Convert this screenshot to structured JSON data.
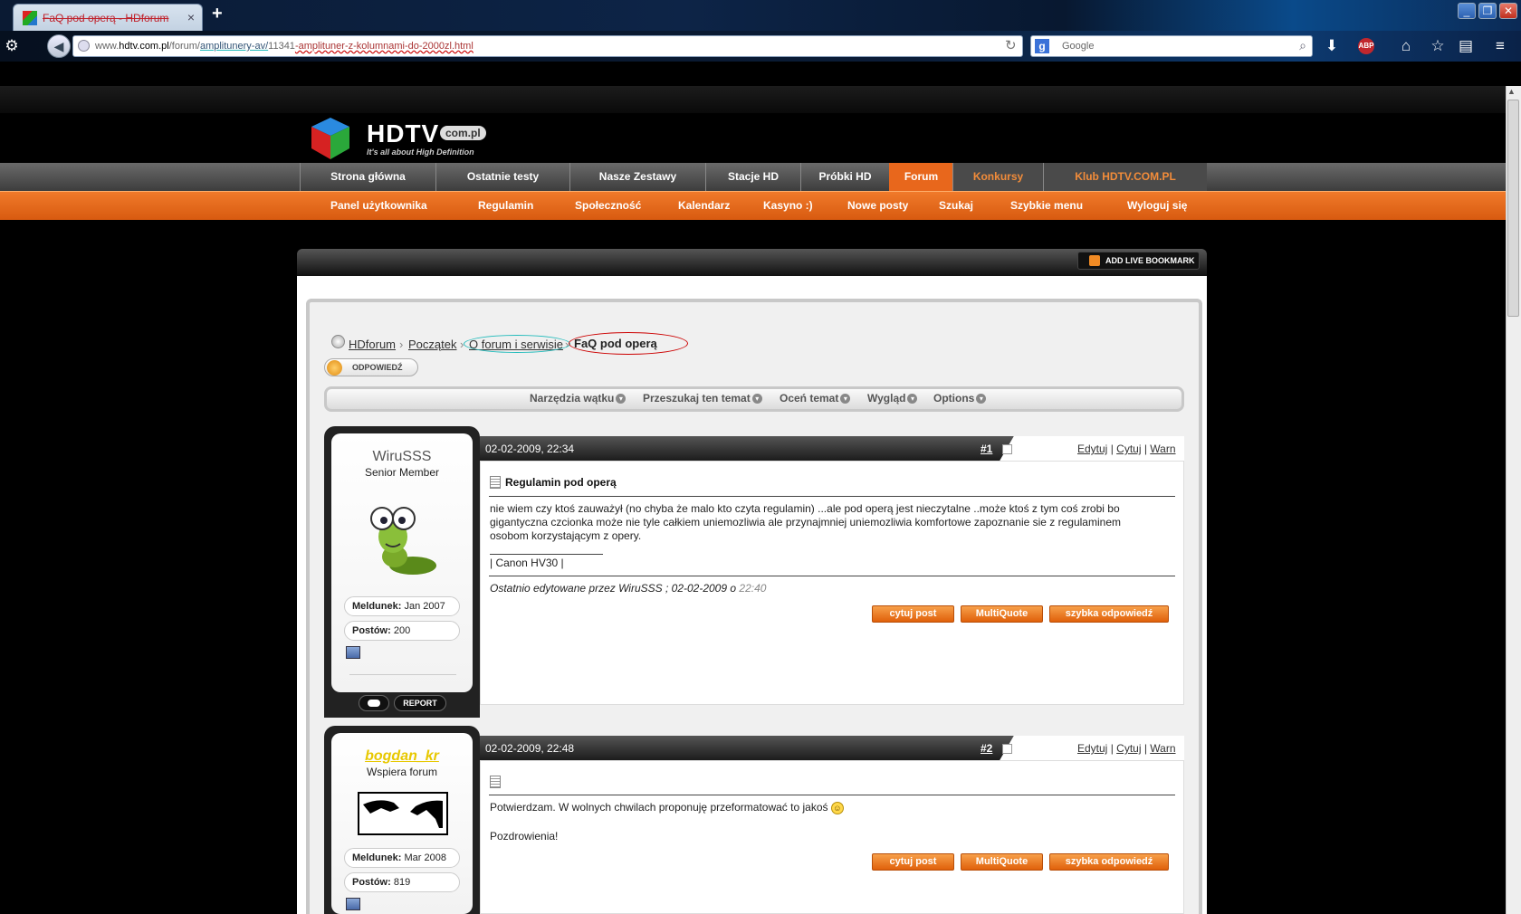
{
  "browser": {
    "tab_title": "FaQ pod operą - HDforum",
    "tab_close": "×",
    "new_tab": "+",
    "url_prefix": "www.",
    "url_domain": "hdtv.com.pl",
    "url_path_a": "/forum/",
    "url_path_b": "amplitunery-av/",
    "url_path_c": "11341",
    "url_path_d": "-amplituner-z-kolumnami-do-2000zl.html",
    "search_placeholder": "Google",
    "search_engine_letter": "g",
    "abp_label": "ABP"
  },
  "site": {
    "logo_text": "HDTV",
    "logo_badge": "com.pl",
    "logo_tagline": "It's all about High Definition",
    "main_nav": [
      "Strona główna",
      "Ostatnie testy",
      "Nasze Zestawy",
      "Stacje HD",
      "Próbki HD",
      "Forum",
      "Konkursy",
      "Klub HDTV.COM.PL"
    ],
    "sub_nav": [
      "Panel użytkownika",
      "Regulamin",
      "Społeczność",
      "Kalendarz",
      "Kasyno :)",
      "Nowe posty",
      "Szukaj",
      "Szybkie menu",
      "Wyloguj się"
    ],
    "rss_label": "ADD LIVE BOOKMARK"
  },
  "breadcrumb": {
    "items": [
      "HDforum",
      "Początek",
      "O forum i serwisie"
    ],
    "separator": "›",
    "current": "FaQ pod operą"
  },
  "reply_button": "ODPOWIEDŹ",
  "tools": [
    "Narzędzia wątku",
    "Przeszukaj ten temat",
    "Oceń temat",
    "Wygląd",
    "Options"
  ],
  "posts": [
    {
      "date": "02-02-2009, 22:34",
      "number": "#1",
      "links": [
        "Edytuj",
        "Cytuj",
        "Warn"
      ],
      "user": "WiruSSS",
      "rank": "Senior Member",
      "joined_label": "Meldunek:",
      "joined": "Jan 2007",
      "posts_label": "Postów:",
      "posts": "200",
      "title": "Regulamin pod operą",
      "text": "nie wiem czy ktoś zauważył (no chyba że malo kto czyta regulamin) ...ale pod operą jest nieczytalne ..może ktoś z tym coś zrobi bo gigantyczna czcionka może nie tyle całkiem uniemozliwia ale przynajmniej uniemozliwia komfortowe zapoznanie sie z regulaminem osobom korzystającym z opery.",
      "signature": "| Canon HV30 |",
      "edited_prefix": "Ostatnio edytowane przez WiruSSS ; 02-02-2009 o",
      "edited_time": "22:40",
      "report_label": "REPORT",
      "user_color": "#444444"
    },
    {
      "date": "02-02-2009, 22:48",
      "number": "#2",
      "links": [
        "Edytuj",
        "Cytuj",
        "Warn"
      ],
      "user": "bogdan_kr",
      "rank": "Wspiera forum",
      "joined_label": "Meldunek:",
      "joined": "Mar 2008",
      "posts_label": "Postów:",
      "posts": "819",
      "text1": "Potwierdzam. W wolnych chwilach proponuję przeformatować to jakoś",
      "text2": "Pozdrowienia!",
      "user_color": "#e8c800"
    }
  ],
  "post_buttons": [
    "cytuj post",
    "MultiQuote",
    "szybka odpowiedź"
  ],
  "colors": {
    "accent": "#e8671c",
    "nav_dark": "#3d3d3d"
  }
}
